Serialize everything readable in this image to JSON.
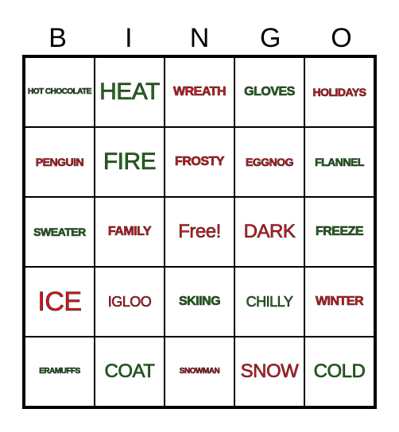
{
  "header": [
    "B",
    "I",
    "N",
    "G",
    "O"
  ],
  "colors": {
    "green": "#1a6b12",
    "red": "#e0121a"
  },
  "cells": [
    {
      "text": "HOT CHOCOLATE",
      "color": "green",
      "size": "s1"
    },
    {
      "text": "HEAT",
      "color": "green",
      "size": "s6"
    },
    {
      "text": "WREATH",
      "color": "red",
      "size": "s3"
    },
    {
      "text": "GLOVES",
      "color": "green",
      "size": "s3"
    },
    {
      "text": "HOLIDAYS",
      "color": "red",
      "size": "s2"
    },
    {
      "text": "PENGUIN",
      "color": "red",
      "size": "s2"
    },
    {
      "text": "FIRE",
      "color": "green",
      "size": "s6"
    },
    {
      "text": "FROSTY",
      "color": "red",
      "size": "s3"
    },
    {
      "text": "EGGNOG",
      "color": "red",
      "size": "s2"
    },
    {
      "text": "FLANNEL",
      "color": "green",
      "size": "s2"
    },
    {
      "text": "SWEATER",
      "color": "green",
      "size": "s2"
    },
    {
      "text": "FAMILY",
      "color": "red",
      "size": "s3"
    },
    {
      "text": "Free!",
      "color": "red",
      "size": "s5"
    },
    {
      "text": "DARK",
      "color": "red",
      "size": "s5"
    },
    {
      "text": "FREEZE",
      "color": "green",
      "size": "s3"
    },
    {
      "text": "ICE",
      "color": "red",
      "size": "s7"
    },
    {
      "text": "IGLOO",
      "color": "red",
      "size": "s4"
    },
    {
      "text": "SKIING",
      "color": "green",
      "size": "s3"
    },
    {
      "text": "CHILLY",
      "color": "green",
      "size": "s4"
    },
    {
      "text": "WINTER",
      "color": "red",
      "size": "s3"
    },
    {
      "text": "ERAMUFFS",
      "color": "green",
      "size": "s1"
    },
    {
      "text": "COAT",
      "color": "green",
      "size": "s5"
    },
    {
      "text": "SNOWMAN",
      "color": "red",
      "size": "s1"
    },
    {
      "text": "SNOW",
      "color": "red",
      "size": "s5"
    },
    {
      "text": "COLD",
      "color": "green",
      "size": "s5"
    }
  ]
}
